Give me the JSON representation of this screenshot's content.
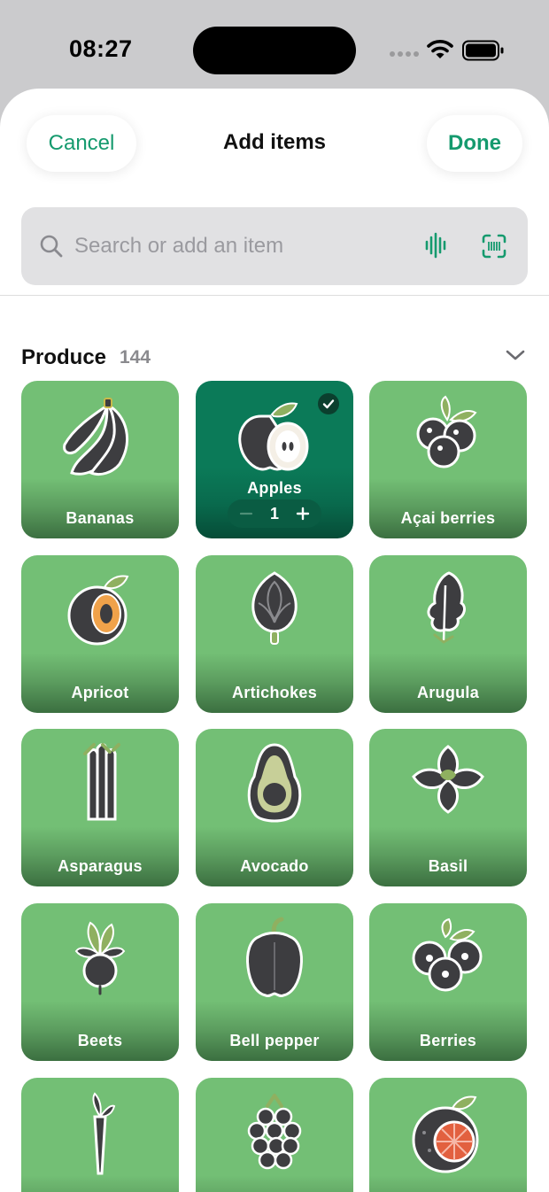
{
  "status": {
    "time": "08:27"
  },
  "nav": {
    "cancel": "Cancel",
    "title": "Add items",
    "done": "Done"
  },
  "search": {
    "placeholder": "Search or add an item"
  },
  "section": {
    "title": "Produce",
    "count": "144"
  },
  "colors": {
    "accent": "#159a6e",
    "tile": "#73bf75",
    "tile_selected": "#0b7a58"
  },
  "items": [
    {
      "label": "Bananas",
      "icon": "bananas-icon",
      "selected": false
    },
    {
      "label": "Apples",
      "icon": "apple-icon",
      "selected": true,
      "quantity": "1"
    },
    {
      "label": "Açai berries",
      "icon": "acai-berries-icon",
      "selected": false
    },
    {
      "label": "Apricot",
      "icon": "apricot-icon",
      "selected": false
    },
    {
      "label": "Artichokes",
      "icon": "artichoke-icon",
      "selected": false
    },
    {
      "label": "Arugula",
      "icon": "arugula-icon",
      "selected": false
    },
    {
      "label": "Asparagus",
      "icon": "asparagus-icon",
      "selected": false
    },
    {
      "label": "Avocado",
      "icon": "avocado-icon",
      "selected": false
    },
    {
      "label": "Basil",
      "icon": "basil-icon",
      "selected": false
    },
    {
      "label": "Beets",
      "icon": "beet-icon",
      "selected": false
    },
    {
      "label": "Bell pepper",
      "icon": "bell-pepper-icon",
      "selected": false
    },
    {
      "label": "Berries",
      "icon": "berries-icon",
      "selected": false
    },
    {
      "label": "",
      "icon": "carrot-icon",
      "selected": false
    },
    {
      "label": "",
      "icon": "blackberry-icon",
      "selected": false
    },
    {
      "label": "",
      "icon": "grapefruit-icon",
      "selected": false
    }
  ]
}
